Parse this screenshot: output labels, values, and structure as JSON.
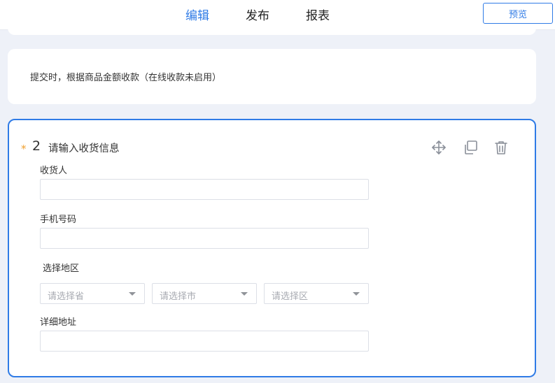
{
  "header": {
    "tabs": [
      {
        "label": "编辑",
        "active": true
      },
      {
        "label": "发布",
        "active": false
      },
      {
        "label": "报表",
        "active": false
      }
    ],
    "preview_label": "预览"
  },
  "info_card": {
    "text": "提交时，根据商品金额收款（在线收款未启用）"
  },
  "question": {
    "required_mark": "*",
    "number": "2",
    "title": "请输入收货信息",
    "tools": [
      "move-icon",
      "copy-icon",
      "delete-icon"
    ],
    "fields": {
      "receiver_label": "收货人",
      "receiver_value": "",
      "phone_label": "手机号码",
      "phone_value": "",
      "region_label": "选择地区",
      "province_placeholder": "请选择省",
      "city_placeholder": "请选择市",
      "district_placeholder": "请选择区",
      "address_label": "详细地址",
      "address_value": ""
    }
  },
  "colors": {
    "accent": "#2f7be6",
    "required": "#f0a030",
    "background": "#eef1f8"
  }
}
